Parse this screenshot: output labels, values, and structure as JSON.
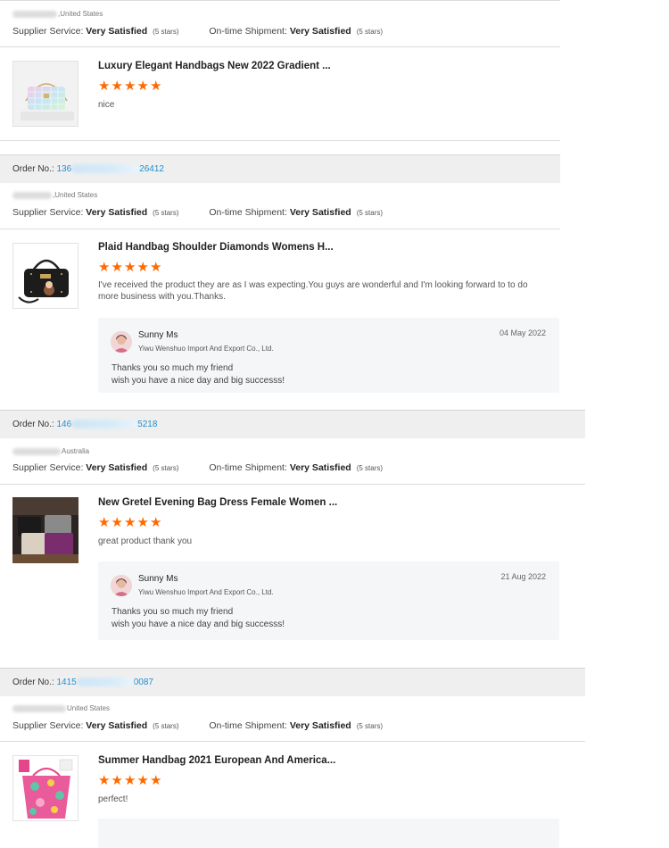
{
  "labels": {
    "order_no": "Order No.:",
    "supplier_service": "Supplier Service:",
    "ontime_shipment": "On-time Shipment:"
  },
  "reviews": [
    {
      "country": ",United States",
      "supplier_rating": "Very Satisfied",
      "supplier_stars": "(5 stars)",
      "shipment_rating": "Very Satisfied",
      "shipment_stars": "(5 stars)",
      "product_title": "Luxury Elegant Handbags New 2022 Gradient ...",
      "stars": 5,
      "text": "nice"
    },
    {
      "order_prefix": "136",
      "order_suffix": "26412",
      "country": ",United States",
      "supplier_rating": "Very Satisfied",
      "supplier_stars": "(5 stars)",
      "shipment_rating": "Very Satisfied",
      "shipment_stars": "(5 stars)",
      "product_title": "Plaid Handbag Shoulder Diamonds Womens H...",
      "stars": 5,
      "text": "I've received the product they are as I was expecting.You guys are wonderful and I'm looking forward to to do more business with you.Thanks.",
      "reply": {
        "name": "Sunny Ms",
        "company": "Yiwu Wenshuo Import And Export Co., Ltd.",
        "date": "04 May 2022",
        "line1": "Thanks you so much my friend",
        "line2": "wish you have a nice day and big successs!"
      }
    },
    {
      "order_prefix": "146",
      "order_suffix": "5218",
      "country": "Australia",
      "supplier_rating": "Very Satisfied",
      "supplier_stars": "(5 stars)",
      "shipment_rating": "Very Satisfied",
      "shipment_stars": "(5 stars)",
      "product_title": "New Gretel Evening Bag Dress Female Women ...",
      "stars": 5,
      "text": "great product thank you",
      "reply": {
        "name": "Sunny Ms",
        "company": "Yiwu Wenshuo Import And Export Co., Ltd.",
        "date": "21 Aug 2022",
        "line1": "Thanks you so much my friend",
        "line2": "wish you have a nice day and big successs!"
      }
    },
    {
      "order_prefix": "1415",
      "order_suffix": "0087",
      "country": "United States",
      "supplier_rating": "Very Satisfied",
      "supplier_stars": "(5 stars)",
      "shipment_rating": "Very Satisfied",
      "shipment_stars": "(5 stars)",
      "product_title": "Summer Handbag 2021 European And America...",
      "stars": 5,
      "text": "perfect!"
    }
  ],
  "colors": {
    "star": "#ff6a00",
    "order_link": "#1f8ed2",
    "order_bar_bg": "#efefef",
    "reply_bg": "#f5f6f8"
  }
}
